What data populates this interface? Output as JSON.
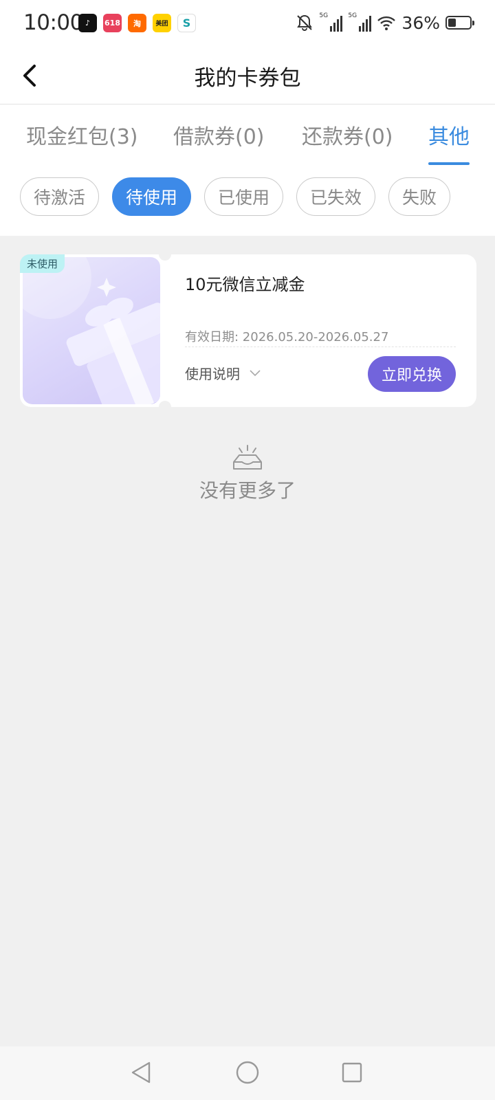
{
  "status_bar": {
    "time": "10:00",
    "apps": [
      "tiktok-icon",
      "taobao-618-icon",
      "taobao-icon",
      "meituan-icon",
      "china-mobile-icon"
    ],
    "app_labels": {
      "tiktok": "♪",
      "p618": "618",
      "taobao": "淘",
      "meituan": "美团",
      "s": "S"
    },
    "net1": "5G",
    "net2": "5G",
    "battery": "36%",
    "battery_level": 0.36
  },
  "nav": {
    "title": "我的卡券包"
  },
  "tabs": [
    {
      "label": "现金红包(3)",
      "active": false
    },
    {
      "label": "借款券(0)",
      "active": false
    },
    {
      "label": "还款券(0)",
      "active": false
    },
    {
      "label": "其他",
      "active": true
    }
  ],
  "filters": [
    {
      "label": "待激活",
      "active": false
    },
    {
      "label": "待使用",
      "active": true
    },
    {
      "label": "已使用",
      "active": false
    },
    {
      "label": "已失效",
      "active": false
    },
    {
      "label": "失败",
      "active": false
    }
  ],
  "coupon": {
    "badge": "未使用",
    "title": "10元微信立减金",
    "validity": "有效日期:  2026.05.20-2026.05.27",
    "usage_label": "使用说明",
    "redeem_label": "立即兑换"
  },
  "empty": {
    "text": "没有更多了"
  },
  "colors": {
    "accent": "#3a8bdf",
    "redeem": "#7264dc",
    "badge": "#bdf2f4"
  }
}
